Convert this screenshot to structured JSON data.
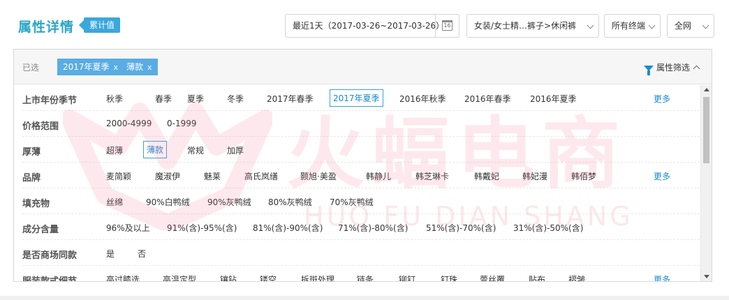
{
  "header": {
    "title": "属性详情",
    "tag": "累计值"
  },
  "controls": {
    "date_range": "最近1天（2017-03-26~2017-03-26）",
    "category": "女装/女士精…裤子>休闲裤",
    "terminal": "所有终端",
    "network": "全网"
  },
  "selected": {
    "label": "已选",
    "chips": [
      "2017年夏季",
      "薄款"
    ],
    "remove": "x",
    "filter_label": "属性筛选"
  },
  "rows": [
    {
      "label": "上市年份季节",
      "options": [
        "秋季",
        "春季",
        "夏季",
        "冬季",
        "2017年春季",
        "2017年夏季",
        "2016年秋季",
        "2016年春季",
        "2016年夏季"
      ],
      "more": "更多"
    },
    {
      "label": "价格范围",
      "options": [
        "2000-4999",
        "0-1999"
      ],
      "more": ""
    },
    {
      "label": "厚薄",
      "options": [
        "超薄",
        "薄款",
        "常规",
        "加厚"
      ],
      "more": ""
    },
    {
      "label": "品牌",
      "options": [
        "麦简颖",
        "魔淑伊",
        "魅莱",
        "高氏岚缮",
        "颢旭·美盈",
        "韩静儿",
        "韩芝琳卡",
        "韩戴妃",
        "韩妃漫",
        "韩佰梦"
      ],
      "more": "更多"
    },
    {
      "label": "填充物",
      "options": [
        "丝绵",
        "90%白鸭绒",
        "90%灰鸭绒",
        "80%灰鸭绒",
        "70%灰鸭绒"
      ],
      "more": ""
    },
    {
      "label": "成分含量",
      "options": [
        "96%及以上",
        "91%(含)-95%(含)",
        "81%(含)-90%(含)",
        "71%(含)-80%(含)",
        "51%(含)-70%(含)",
        "31%(含)-50%(含)"
      ],
      "more": ""
    },
    {
      "label": "是否商场同款",
      "options": [
        "是",
        "否"
      ],
      "more": ""
    },
    {
      "label": "服装款式细节",
      "options": [
        "高过膝选",
        "高温定型",
        "镶钻",
        "镂空",
        "拆斑处理",
        "链条",
        "铆钉",
        "钉珠",
        "蕾丝覆",
        "贴布",
        "褶皱"
      ],
      "more": "更多"
    }
  ],
  "watermark": {
    "cn": "火蝠电商",
    "en": "HUO FU DIAN SHANG"
  },
  "colors": {
    "accent": "#1a8ad4",
    "chip": "#5aace4",
    "title": "#2aa6c9"
  }
}
